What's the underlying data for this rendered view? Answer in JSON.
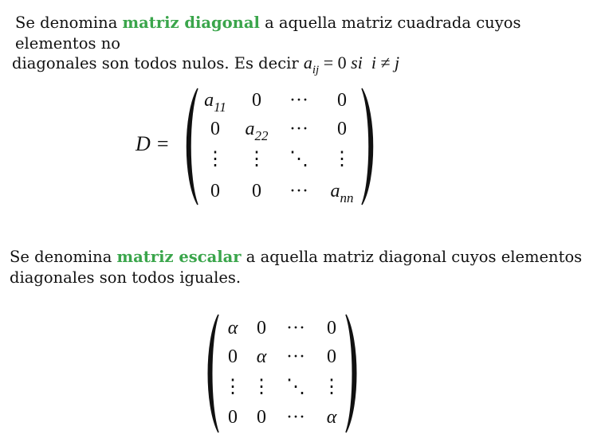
{
  "diagonal": {
    "intro": "Se denomina ",
    "term": "matriz diagonal",
    "line1_rest": " a aquella matriz cuadrada cuyos",
    "line2": "elementos no",
    "line3": "diagonales son todos nulos. Es decir ",
    "condition": {
      "a": "a",
      "sub": "ij",
      "eq": "= 0",
      "si": "si",
      "i": "i",
      "neq": "≠",
      "j": "j"
    },
    "matrix_label": "D =",
    "matrix": [
      [
        "a",
        "0",
        "···",
        "0"
      ],
      [
        "0",
        "a",
        "···",
        "0"
      ],
      [
        "⋮",
        "⋮",
        "⋱",
        "⋮"
      ],
      [
        "0",
        "0",
        "···",
        "a"
      ]
    ],
    "subscripts": {
      "a11": "11",
      "a22": "22",
      "ann": "nn"
    }
  },
  "escalar": {
    "intro": "Se denomina ",
    "term": "matriz escalar",
    "line1_rest": " a aquella matriz diagonal cuyos elementos",
    "line2": "diagonales son todos iguales.",
    "matrix": [
      [
        "α",
        "0",
        "···",
        "0"
      ],
      [
        "0",
        "α",
        "···",
        "0"
      ],
      [
        "⋮",
        "⋮",
        "⋱",
        "⋮"
      ],
      [
        "0",
        "0",
        "···",
        "α"
      ]
    ]
  },
  "colors": {
    "highlight": "#3aa54b",
    "text": "#111111"
  }
}
